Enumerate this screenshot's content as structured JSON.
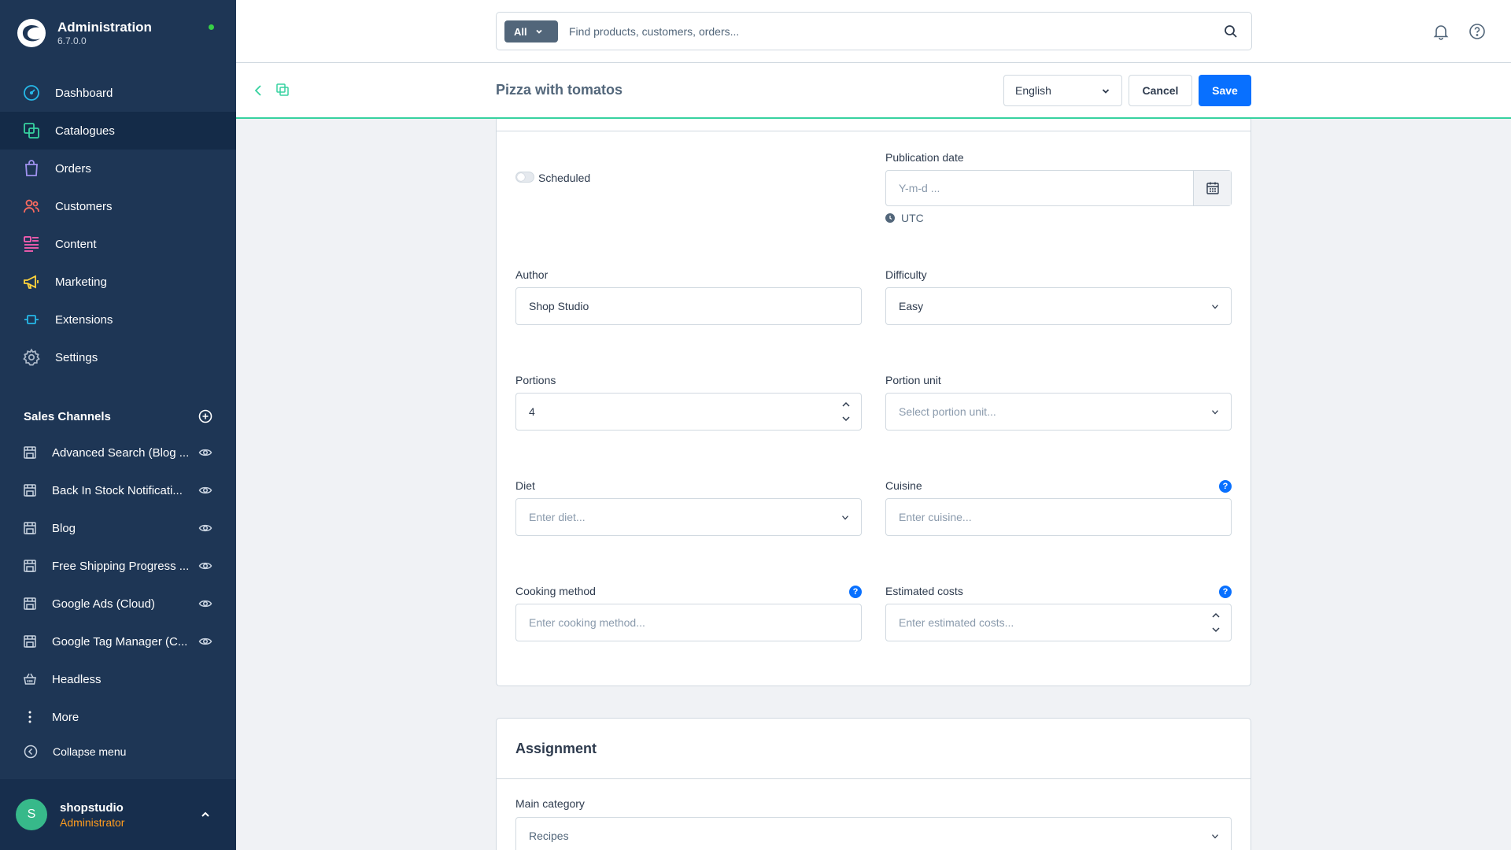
{
  "app": {
    "title": "Administration",
    "version": "6.7.0.0"
  },
  "nav": [
    {
      "label": "Dashboard",
      "icon": "dashboard-icon",
      "active": false
    },
    {
      "label": "Catalogues",
      "icon": "catalogues-icon",
      "active": true
    },
    {
      "label": "Orders",
      "icon": "orders-icon",
      "active": false
    },
    {
      "label": "Customers",
      "icon": "customers-icon",
      "active": false
    },
    {
      "label": "Content",
      "icon": "content-icon",
      "active": false
    },
    {
      "label": "Marketing",
      "icon": "marketing-icon",
      "active": false
    },
    {
      "label": "Extensions",
      "icon": "extensions-icon",
      "active": false
    },
    {
      "label": "Settings",
      "icon": "settings-icon",
      "active": false
    }
  ],
  "sales_channels": {
    "title": "Sales Channels",
    "items": [
      "Advanced Search (Blog ...",
      "Back In Stock Notificati...",
      "Blog",
      "Free Shipping Progress ...",
      "Google Ads (Cloud)",
      "Google Tag Manager (C...",
      "Headless",
      "More"
    ]
  },
  "collapse_label": "Collapse menu",
  "user": {
    "initial": "S",
    "name": "shopstudio",
    "role": "Administrator"
  },
  "search": {
    "scope": "All",
    "placeholder": "Find products, customers, orders..."
  },
  "smartbar": {
    "title": "Pizza with tomatos",
    "language": "English",
    "cancel": "Cancel",
    "save": "Save"
  },
  "form": {
    "scheduled_label": "Scheduled",
    "publication_date": {
      "label": "Publication date",
      "placeholder": "Y-m-d ...",
      "timezone": "UTC"
    },
    "author": {
      "label": "Author",
      "value": "Shop Studio"
    },
    "difficulty": {
      "label": "Difficulty",
      "value": "Easy"
    },
    "portions": {
      "label": "Portions",
      "value": "4"
    },
    "portion_unit": {
      "label": "Portion unit",
      "placeholder": "Select portion unit..."
    },
    "diet": {
      "label": "Diet",
      "placeholder": "Enter diet..."
    },
    "cuisine": {
      "label": "Cuisine",
      "placeholder": "Enter cuisine...",
      "help": "?"
    },
    "cooking_method": {
      "label": "Cooking method",
      "placeholder": "Enter cooking method...",
      "help": "?"
    },
    "estimated_costs": {
      "label": "Estimated costs",
      "placeholder": "Enter estimated costs...",
      "help": "?"
    }
  },
  "assignment": {
    "title": "Assignment",
    "main_category": {
      "label": "Main category",
      "value": "Recipes"
    }
  },
  "colors": {
    "sidebar": "#1e3655",
    "accent": "#0870ff",
    "brand_green": "#37d2a0"
  }
}
